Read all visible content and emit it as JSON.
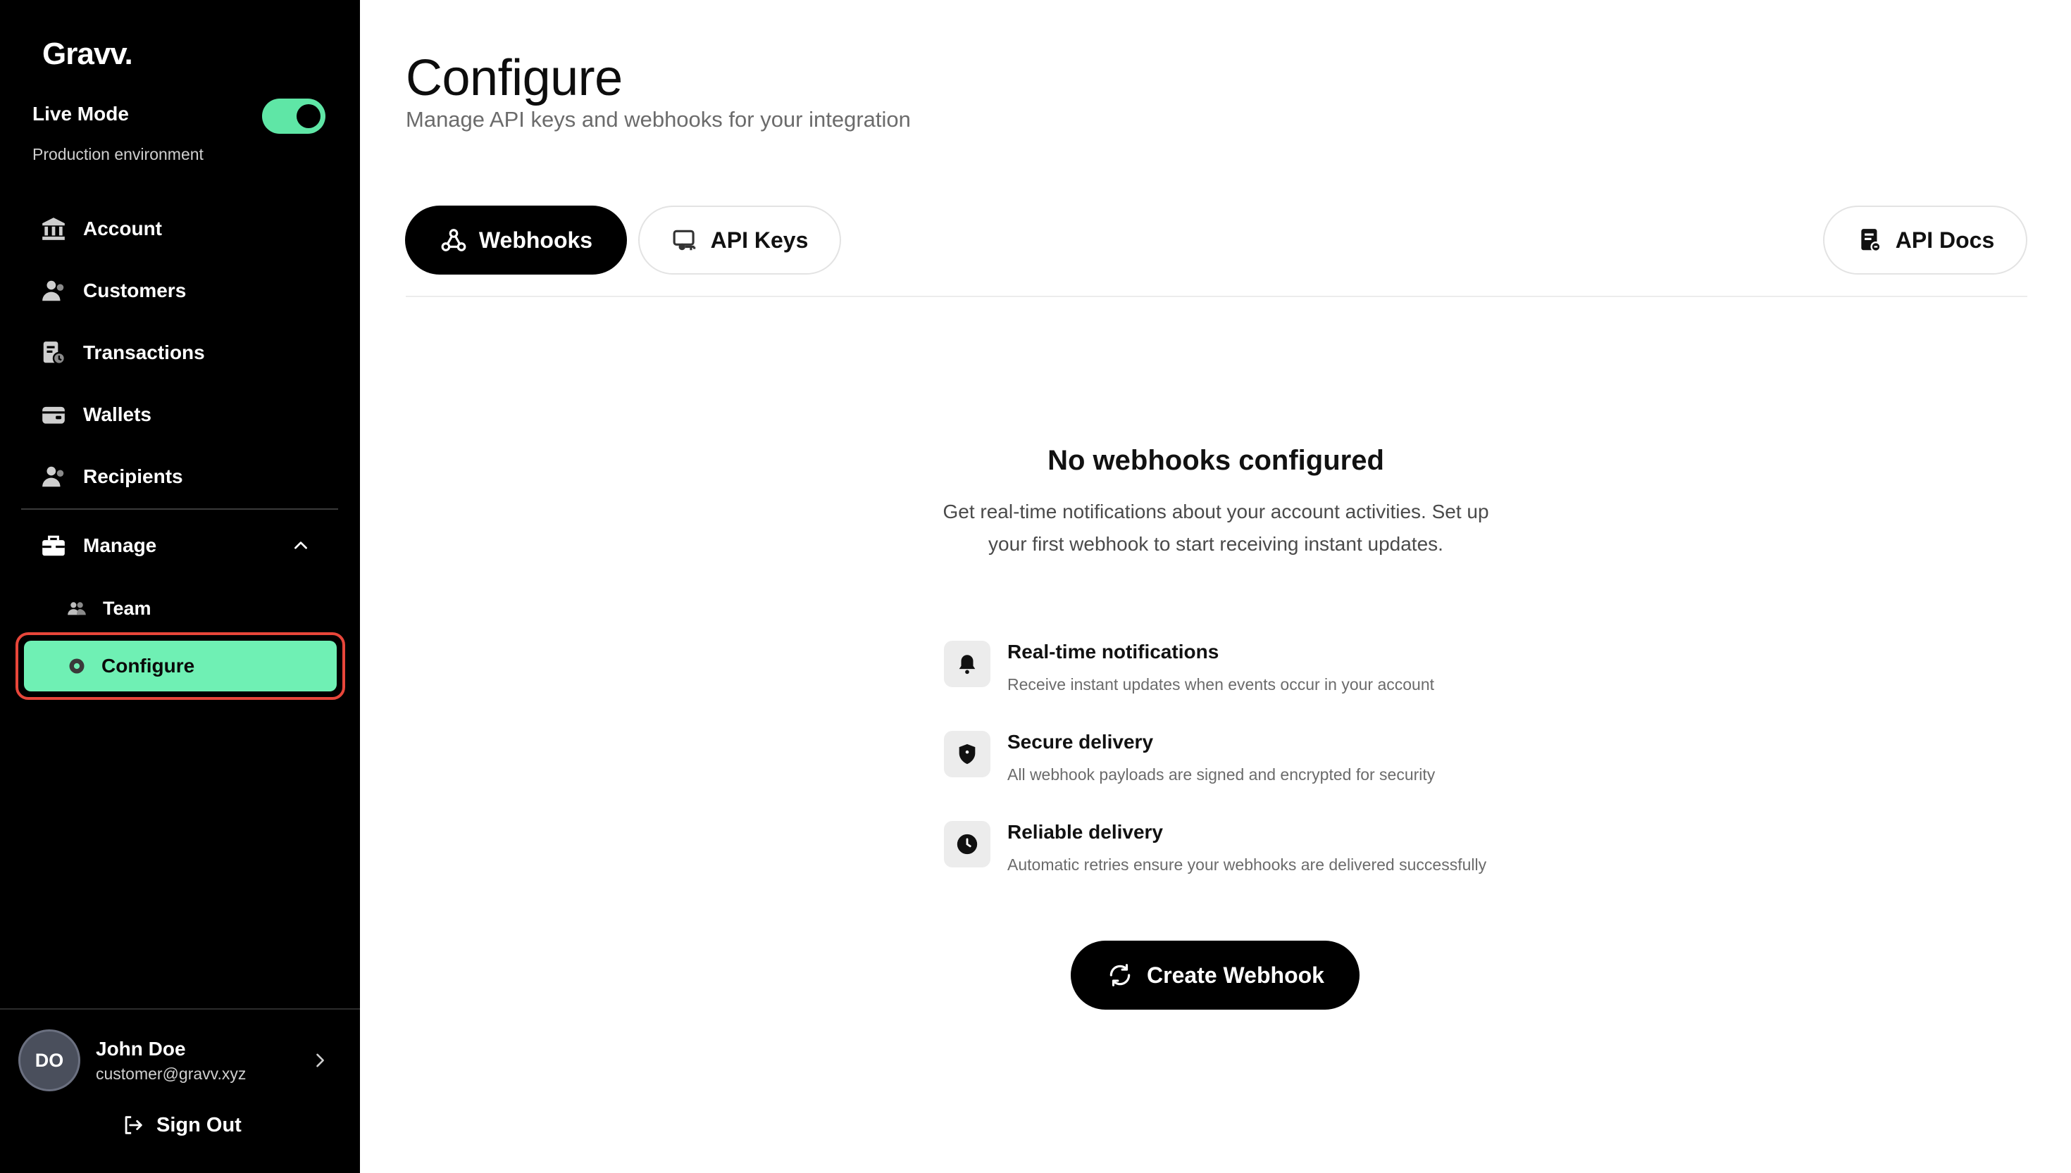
{
  "brand": {
    "logo_text": "Gravv.",
    "accent": "#6ff0b4",
    "highlight_border": "#e8463a"
  },
  "mode": {
    "title": "Live Mode",
    "subtitle": "Production environment",
    "enabled": true
  },
  "sidebar": {
    "items": [
      {
        "label": "Account",
        "icon": "bank-icon"
      },
      {
        "label": "Customers",
        "icon": "users-icon"
      },
      {
        "label": "Transactions",
        "icon": "receipt-icon"
      },
      {
        "label": "Wallets",
        "icon": "wallet-icon"
      },
      {
        "label": "Recipients",
        "icon": "recipients-icon"
      }
    ],
    "manage": {
      "label": "Manage",
      "icon": "briefcase-icon",
      "expanded": true,
      "children": [
        {
          "label": "Team",
          "icon": "team-icon"
        },
        {
          "label": "Configure",
          "icon": "gear-icon",
          "active": true
        }
      ]
    },
    "user": {
      "initials": "DO",
      "name": "John Doe",
      "email": "customer@gravv.xyz"
    },
    "signout_label": "Sign Out"
  },
  "main": {
    "title": "Configure",
    "subtitle": "Manage API keys and webhooks for your integration",
    "tabs": [
      {
        "label": "Webhooks",
        "icon": "webhook-icon",
        "active": true
      },
      {
        "label": "API Keys",
        "icon": "key-icon",
        "active": false
      }
    ],
    "docs_button": {
      "label": "API Docs",
      "icon": "document-icon"
    },
    "empty_state": {
      "title": "No webhooks configured",
      "description": "Get real-time notifications about your account activities. Set up your first webhook to start receiving instant updates.",
      "features": [
        {
          "icon": "bell-icon",
          "title": "Real-time notifications",
          "description": "Receive instant updates when events occur in your account"
        },
        {
          "icon": "shield-icon",
          "title": "Secure delivery",
          "description": "All webhook payloads are signed and encrypted for security"
        },
        {
          "icon": "clock-icon",
          "title": "Reliable delivery",
          "description": "Automatic retries ensure your webhooks are delivered successfully"
        }
      ],
      "cta_label": "Create Webhook",
      "cta_icon": "refresh-icon"
    }
  }
}
